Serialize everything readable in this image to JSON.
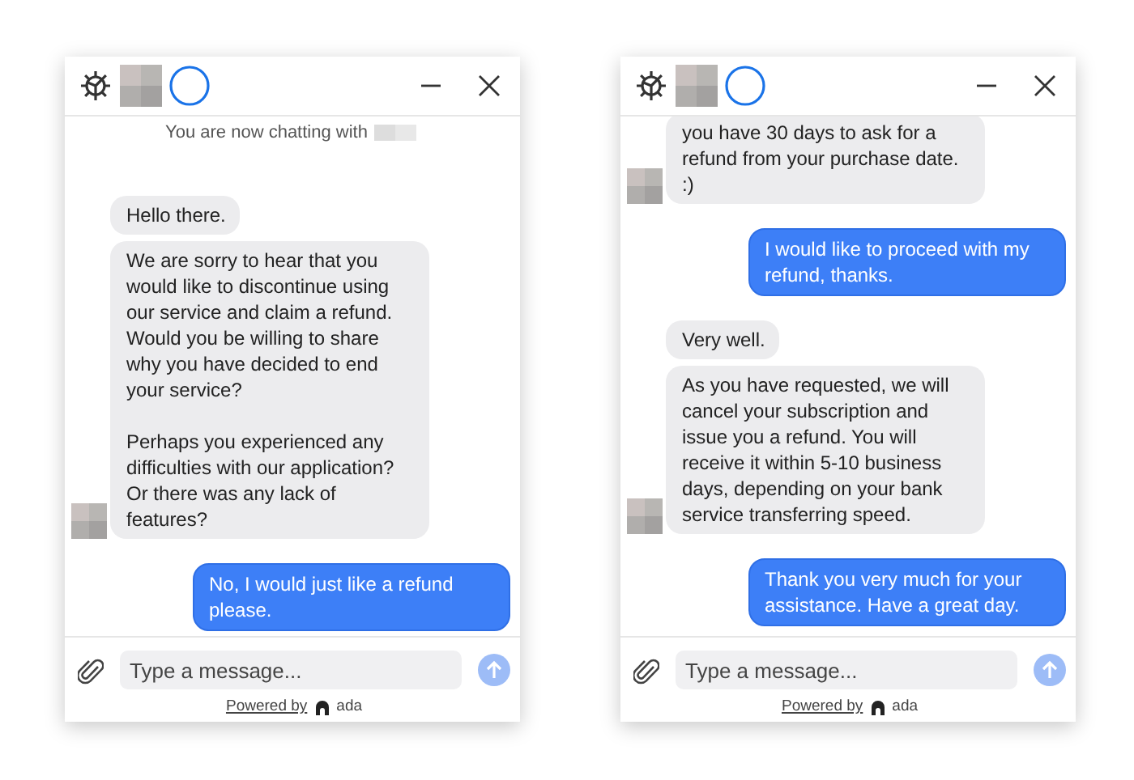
{
  "windows": [
    {
      "notice": "You are now chatting with",
      "messages": [
        {
          "kind": "bot",
          "bubbles": [
            "Hello there.",
            "We are sorry to hear that you would like to discontinue using our service and claim a refund. Would you be willing to share why you have decided to end your service?\n\nPerhaps you experienced any difficulties with our application? Or there was any lack of features?"
          ]
        },
        {
          "kind": "user",
          "bubbles": [
            "No, I would just like a refund please."
          ]
        }
      ],
      "composer": {
        "placeholder": "Type a message..."
      },
      "powered_by": {
        "label": "Powered by",
        "brand": "ada"
      }
    },
    {
      "messages": [
        {
          "kind": "bot",
          "bubbles": [
            "you have 30 days to ask for a refund from your purchase date. :)"
          ]
        },
        {
          "kind": "user",
          "bubbles": [
            "I would like to proceed with my refund, thanks."
          ]
        },
        {
          "kind": "bot",
          "bubbles": [
            "Very well.",
            "As you have requested, we will cancel your subscription and issue you a refund. You will receive it within 5-10 business days, depending on your bank service transferring speed."
          ]
        },
        {
          "kind": "user",
          "bubbles": [
            "Thank you very much for your assistance. Have a great day."
          ]
        }
      ],
      "composer": {
        "placeholder": "Type a message..."
      },
      "powered_by": {
        "label": "Powered by",
        "brand": "ada"
      }
    }
  ]
}
